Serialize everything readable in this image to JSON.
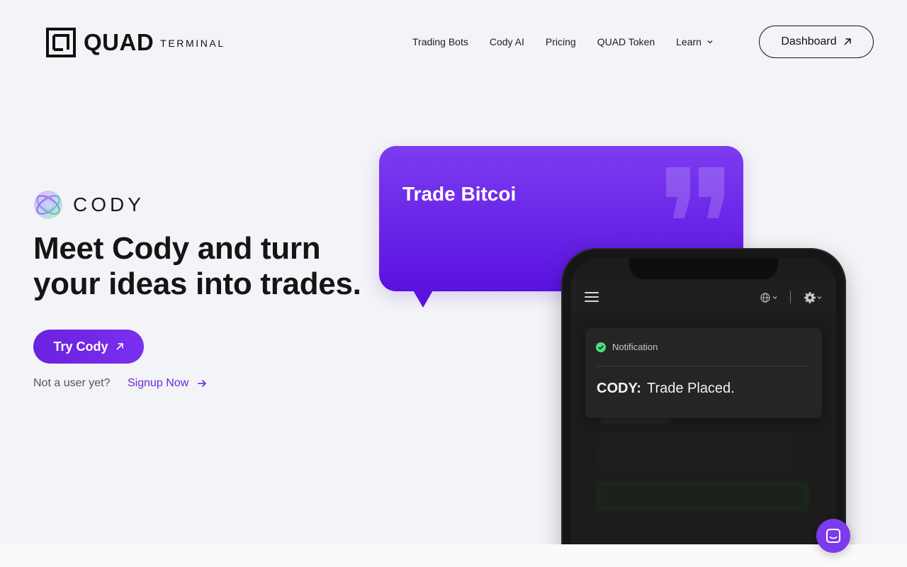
{
  "header": {
    "logo_word": "QUAD",
    "logo_sub": "TERMINAL",
    "nav": [
      {
        "label": "Trading Bots"
      },
      {
        "label": "Cody AI"
      },
      {
        "label": "Pricing"
      },
      {
        "label": "QUAD Token"
      },
      {
        "label": "Learn"
      }
    ],
    "dashboard_label": "Dashboard"
  },
  "hero": {
    "brand": "CODY",
    "title_line1": "Meet Cody and turn",
    "title_line2": "your ideas into trades.",
    "cta_label": "Try Cody",
    "not_user_text": "Not a user yet?",
    "signup_label": "Signup Now"
  },
  "bubble": {
    "text": "Trade Bitcoi"
  },
  "phone": {
    "notification_title": "Notification",
    "sender": "CODY:",
    "message": "Trade Placed."
  },
  "colors": {
    "accent": "#6d28d9",
    "bubble_top": "#7c3cf0",
    "bubble_bottom": "#5b12e0",
    "success": "#4ade80"
  },
  "icons": [
    "quad-logo-icon",
    "chevron-down-icon",
    "arrow-up-right-icon",
    "cody-orb-icon",
    "arrow-right-icon",
    "quote-icon",
    "menu-icon",
    "globe-icon",
    "gear-icon",
    "check-circle-icon",
    "chat-icon"
  ]
}
